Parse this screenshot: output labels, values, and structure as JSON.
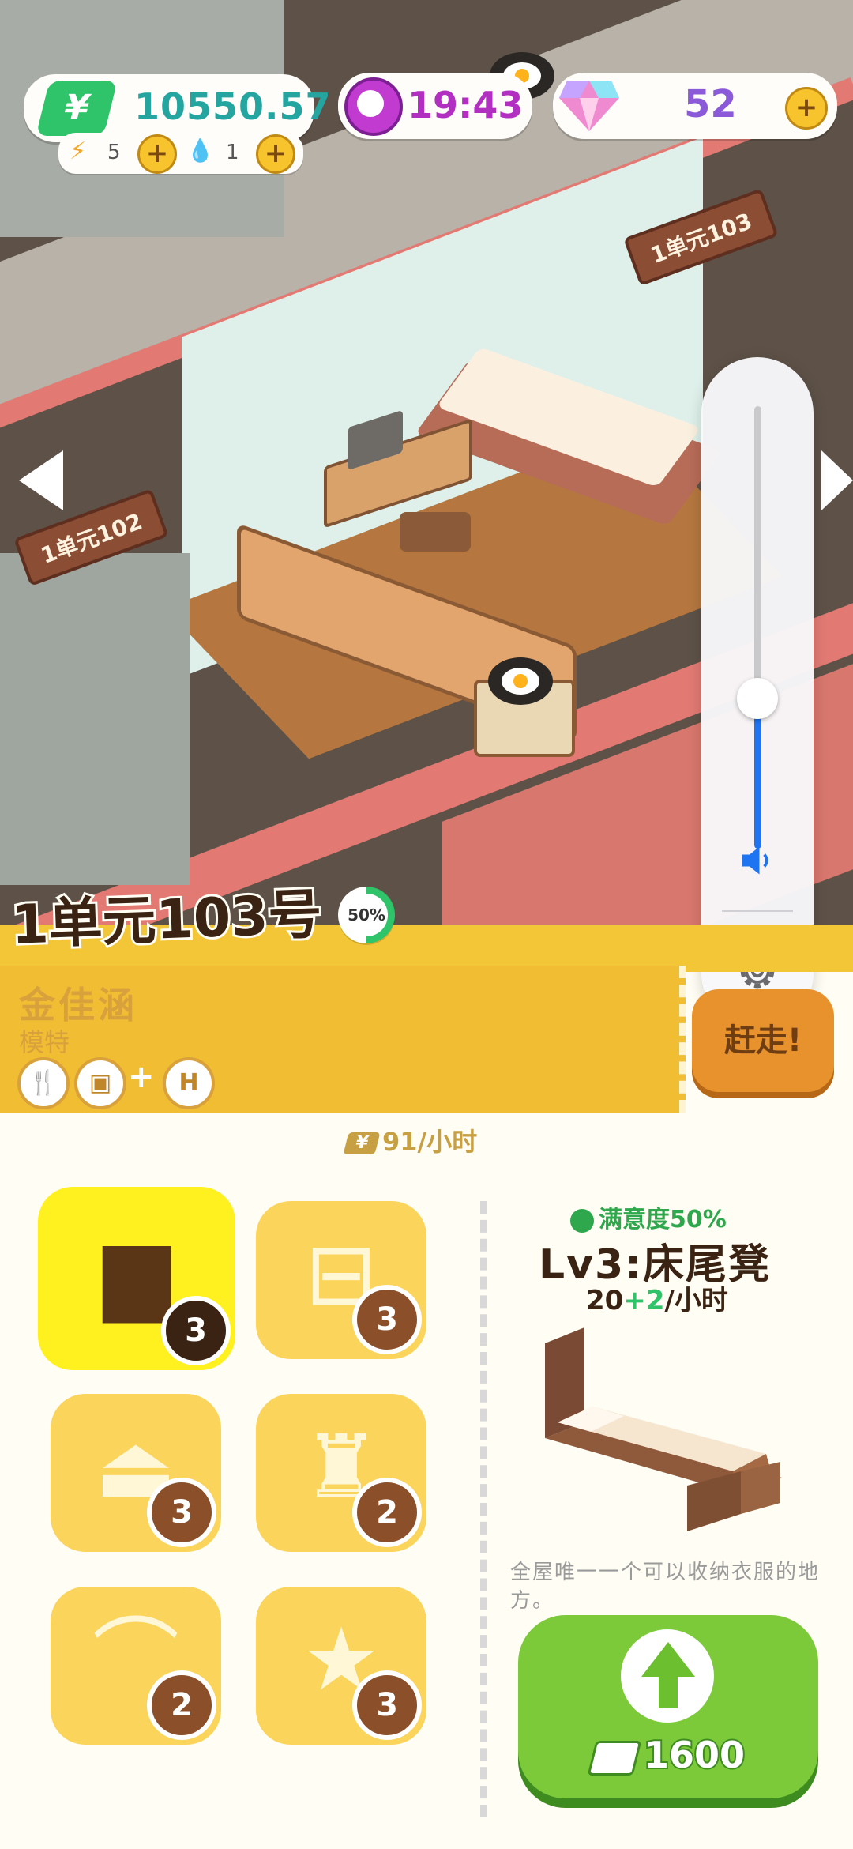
{
  "hud": {
    "money": "10550.57",
    "energy": "5",
    "water": "1",
    "time": "19:43",
    "gems": "52"
  },
  "scene": {
    "signs": [
      "1单元103",
      "1单元102"
    ]
  },
  "volume": {
    "level": 0.34
  },
  "room": {
    "title": "1单元103号",
    "satisfaction_badge": "50%",
    "tenant_name": "金佳涵",
    "tenant_job": "模特",
    "evict_label": "赶走!",
    "rent": "91/小时"
  },
  "furniture": {
    "tiles": [
      {
        "name": "bed",
        "count": "3",
        "selected": true
      },
      {
        "name": "desk",
        "count": "3"
      },
      {
        "name": "range-hood",
        "count": "3"
      },
      {
        "name": "toilet",
        "count": "2"
      },
      {
        "name": "shower",
        "count": "2"
      },
      {
        "name": "decor",
        "count": "3"
      }
    ],
    "detail": {
      "satisfaction": "满意度50%",
      "title": "Lv3:床尾凳",
      "rate_base": "20",
      "rate_bonus": "+2",
      "rate_unit": "/小时",
      "description": "全屋唯一一个可以收纳衣服的地方。",
      "upgrade_cost": "1600"
    }
  }
}
